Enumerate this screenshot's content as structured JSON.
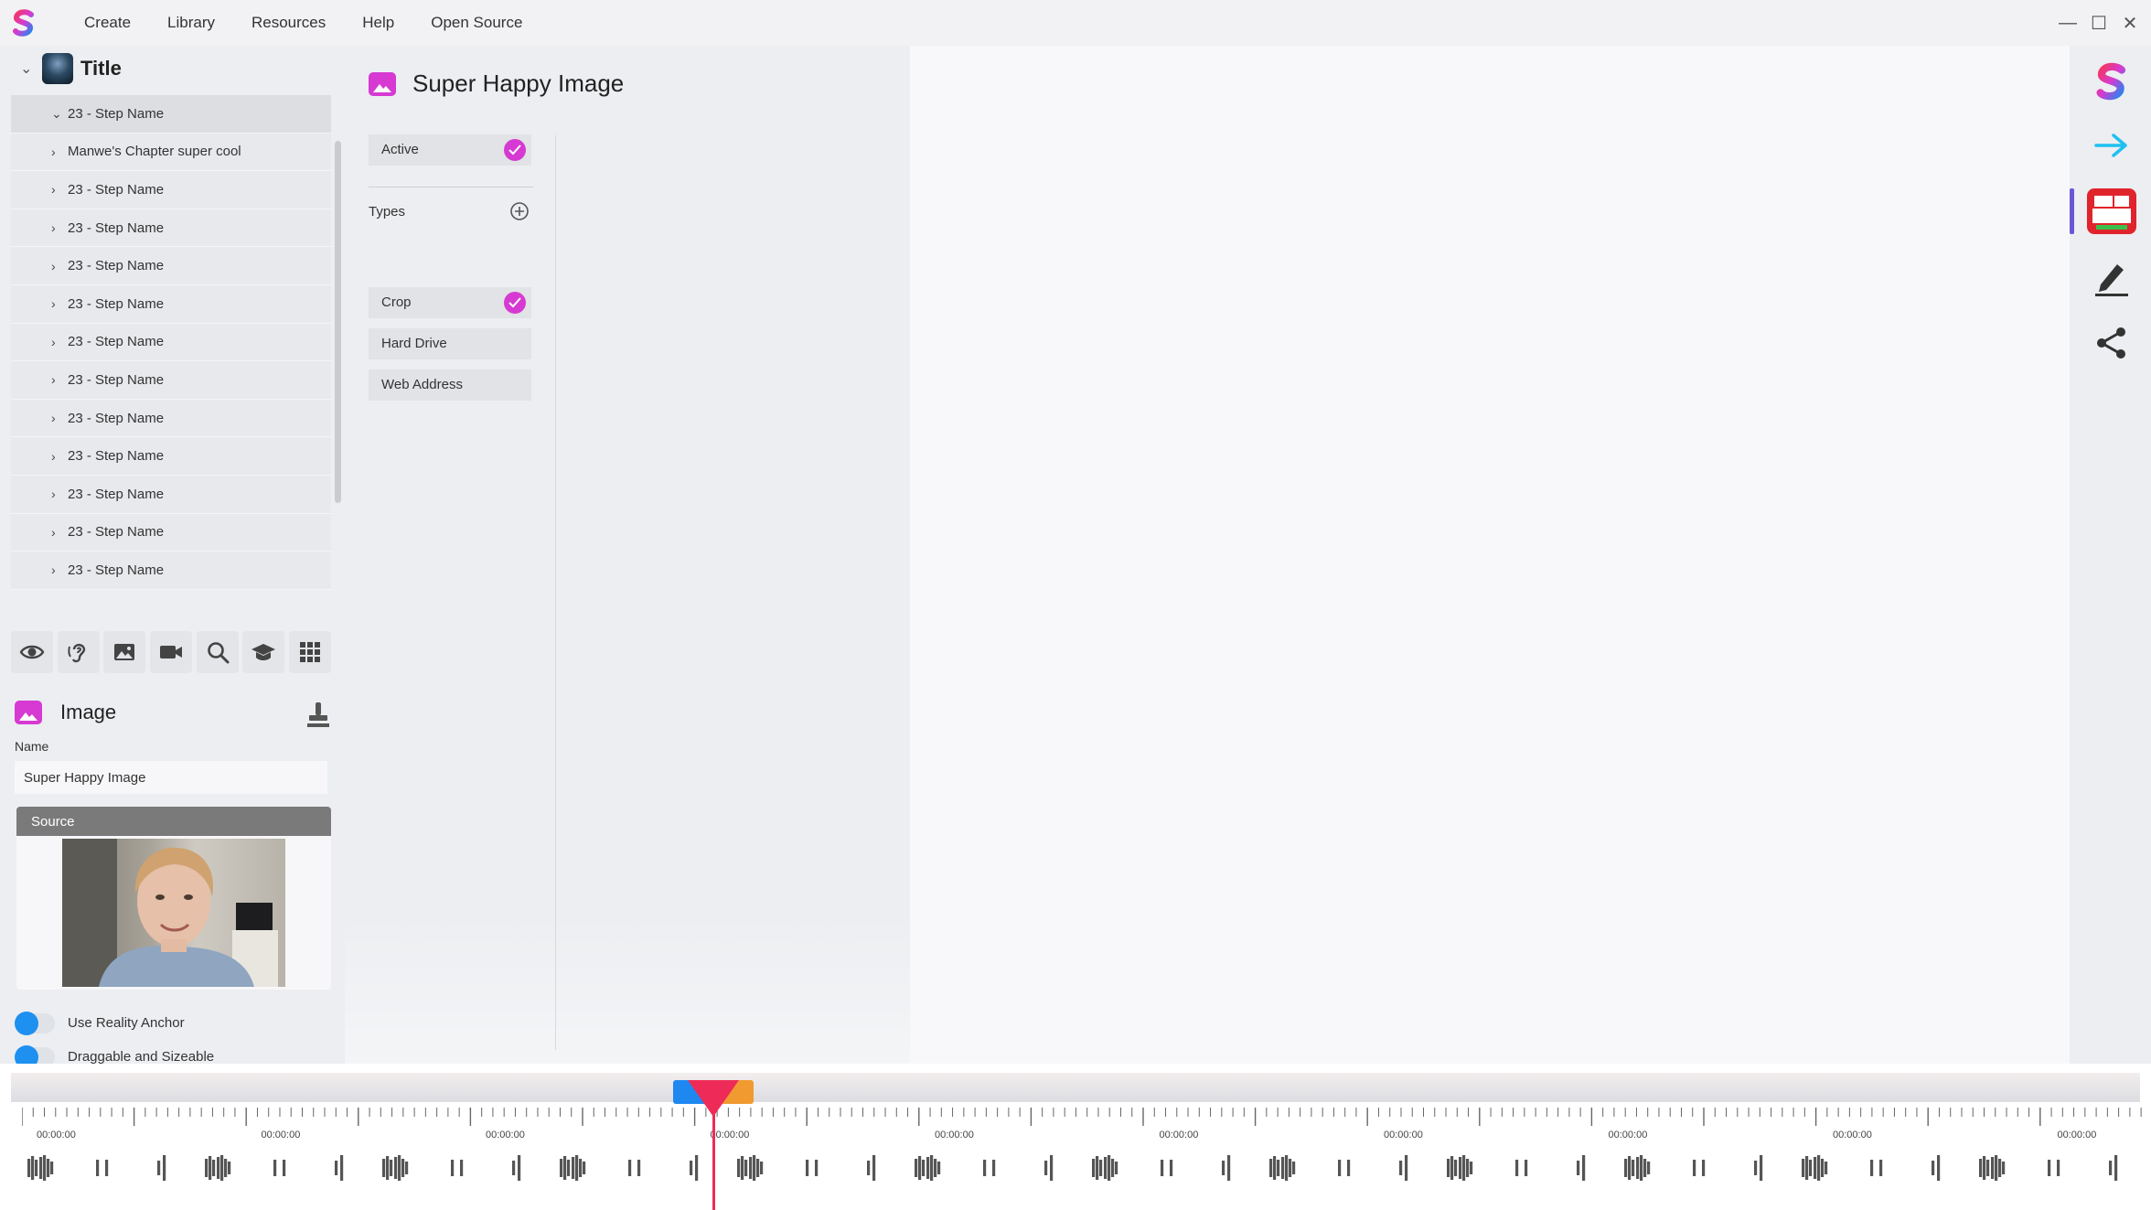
{
  "menu": {
    "items": [
      "Create",
      "Library",
      "Resources",
      "Help",
      "Open Source"
    ]
  },
  "tree": {
    "title": "Title",
    "items": [
      {
        "label": "23 - Step Name",
        "expanded": true
      },
      {
        "label": "Manwe's Chapter super cool"
      },
      {
        "label": "23 - Step Name"
      },
      {
        "label": "23 - Step Name"
      },
      {
        "label": "23 - Step Name"
      },
      {
        "label": "23 - Step Name"
      },
      {
        "label": "23 - Step Name"
      },
      {
        "label": "23 - Step Name"
      },
      {
        "label": "23 - Step Name"
      },
      {
        "label": "23 - Step Name"
      },
      {
        "label": "23 - Step Name"
      },
      {
        "label": "23 - Step Name"
      },
      {
        "label": "23 - Step Name"
      }
    ]
  },
  "toolbar": {
    "icons": [
      "eye-icon",
      "hearing-icon",
      "image-icon",
      "video-camera-icon",
      "search-icon",
      "graduation-cap-icon",
      "grid-icon"
    ]
  },
  "properties": {
    "title": "Image",
    "name_label": "Name",
    "name_value": "Super Happy Image",
    "source_label": "Source",
    "toggles": [
      "Use Reality Anchor",
      "Draggable and Sizeable"
    ]
  },
  "middle": {
    "title": "Super Happy Image",
    "active_label": "Active",
    "types_label": "Types",
    "types": [
      {
        "label": "Crop",
        "checked": true
      },
      {
        "label": "Hard Drive",
        "checked": false
      },
      {
        "label": "Web Address",
        "checked": false
      }
    ]
  },
  "right_rail": {
    "icons": [
      "brand-s-icon",
      "arrow-right-icon",
      "game-gen-icon",
      "pen-icon",
      "share-icon"
    ]
  },
  "timeline": {
    "timecode_label": "00:00:00",
    "timecodes": [
      "00:00:00",
      "00:00:00",
      "00:00:00",
      "00:00:00",
      "00:00:00",
      "00:00:00",
      "00:00:00",
      "00:00:00",
      "00:00:00",
      "00:00:00"
    ],
    "colors": {
      "playhead": "#ee2b58",
      "clip_left": "#1e88f0",
      "clip_right": "#f09a30"
    }
  },
  "colors": {
    "accent_magenta": "#d63ad2",
    "toggle_blue": "#1e90f0"
  }
}
